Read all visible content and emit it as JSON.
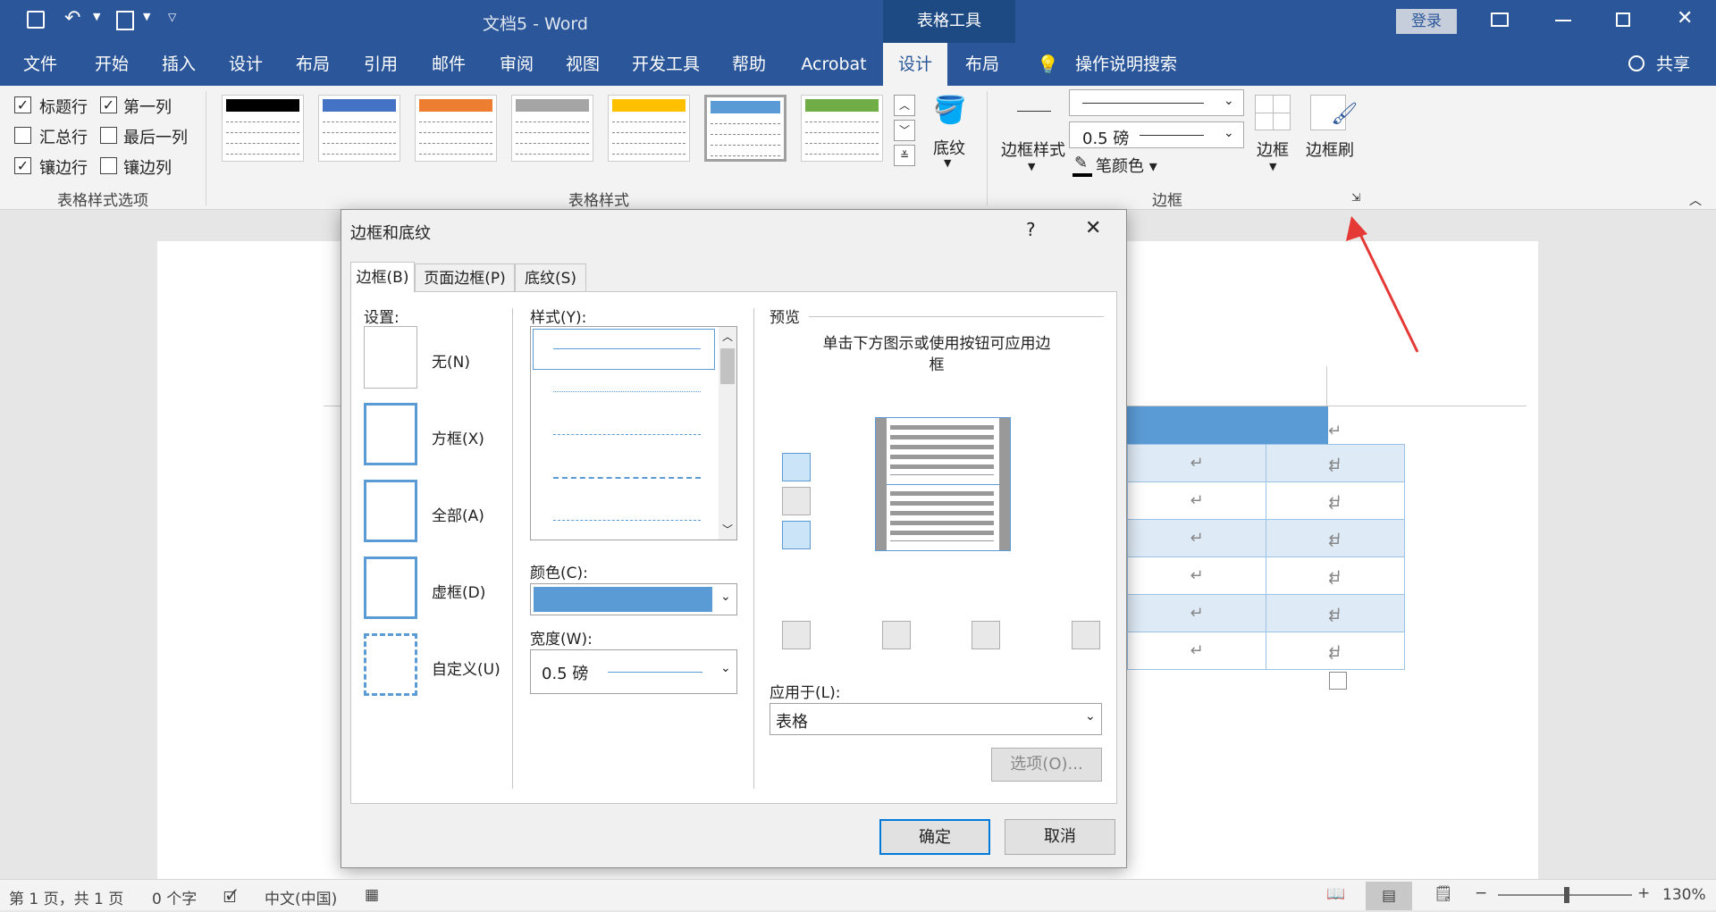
{
  "title": {
    "doc": "文档5",
    "sep": "-",
    "app": "Word",
    "context": "表格工具",
    "login": "登录"
  },
  "tabs": [
    "文件",
    "开始",
    "插入",
    "设计",
    "布局",
    "引用",
    "邮件",
    "审阅",
    "视图",
    "开发工具",
    "帮助",
    "Acrobat",
    "设计",
    "布局"
  ],
  "tell_me": "操作说明搜索",
  "share": "共享",
  "ribbon": {
    "options": {
      "header_row": "标题行",
      "first_col": "第一列",
      "total_row": "汇总行",
      "last_col": "最后一列",
      "banded_rows": "镶边行",
      "banded_cols": "镶边列",
      "group": "表格样式选项"
    },
    "styles_group": "表格样式",
    "shading": "底纹",
    "borders": {
      "style_btn": "边框样式",
      "weight": "0.5 磅",
      "pen_color": "笔颜色",
      "borders_btn": "边框",
      "painter": "边框刷",
      "group": "边框"
    },
    "style_colors": [
      "#000000",
      "#4472c4",
      "#ed7d31",
      "#a5a5a5",
      "#ffc000",
      "#5b9bd5",
      "#70ad47"
    ]
  },
  "dialog": {
    "title": "边框和底纹",
    "help": "?",
    "close": "✕",
    "tabs": [
      "边框(B)",
      "页面边框(P)",
      "底纹(S)"
    ],
    "setting_label": "设置:",
    "settings": [
      "无(N)",
      "方框(X)",
      "全部(A)",
      "虚框(D)",
      "自定义(U)"
    ],
    "style_label": "样式(Y):",
    "color_label": "颜色(C):",
    "color_value": "#5b9bd5",
    "width_label": "宽度(W):",
    "width_value": "0.5 磅",
    "preview_label": "预览",
    "preview_hint": "单击下方图示或使用按钮可应用边框",
    "apply_label": "应用于(L):",
    "apply_value": "表格",
    "options_btn": "选项(O)...",
    "ok": "确定",
    "cancel": "取消"
  },
  "status": {
    "page": "第 1 页，共 1 页",
    "words": "0 个字",
    "lang": "中文(中国)",
    "zoom": "130%"
  }
}
